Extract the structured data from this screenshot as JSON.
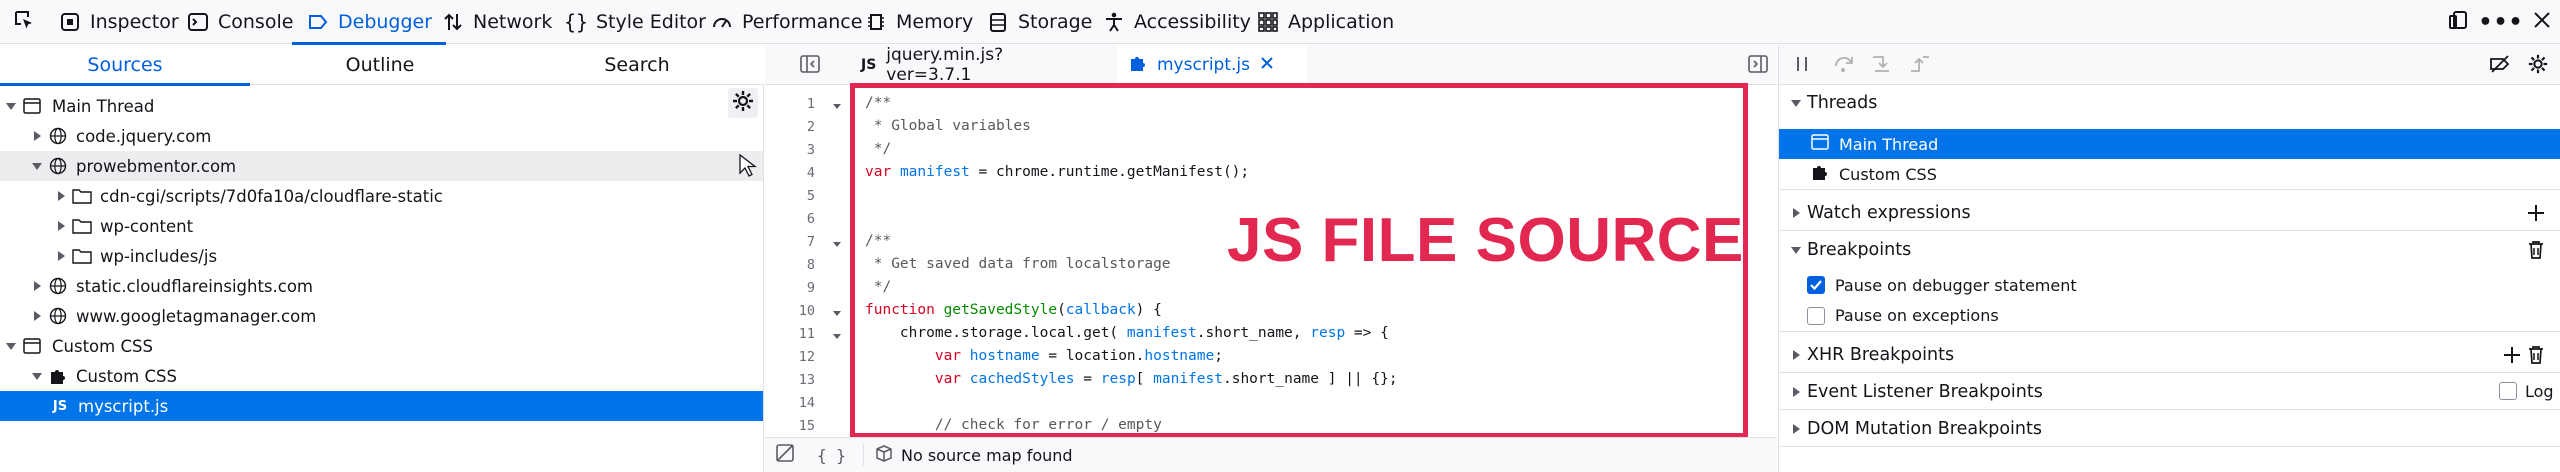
{
  "toolbar": {
    "tabs": [
      {
        "label": "Inspector",
        "icon": "inspector-icon"
      },
      {
        "label": "Console",
        "icon": "console-icon"
      },
      {
        "label": "Debugger",
        "icon": "debugger-icon"
      },
      {
        "label": "Network",
        "icon": "network-icon"
      },
      {
        "label": "Style Editor",
        "icon": "style-editor-icon"
      },
      {
        "label": "Performance",
        "icon": "performance-icon"
      },
      {
        "label": "Memory",
        "icon": "memory-icon"
      },
      {
        "label": "Storage",
        "icon": "storage-icon"
      },
      {
        "label": "Accessibility",
        "icon": "accessibility-icon"
      },
      {
        "label": "Application",
        "icon": "application-icon"
      }
    ],
    "selected_tab": "Debugger"
  },
  "sources_panel": {
    "tabs": [
      "Sources",
      "Outline",
      "Search"
    ],
    "selected_tab": "Sources",
    "tree": [
      {
        "label": "Main Thread",
        "type": "thread",
        "expanded": true
      },
      {
        "label": "code.jquery.com",
        "type": "domain",
        "expanded": false
      },
      {
        "label": "prowebmentor.com",
        "type": "domain",
        "expanded": true
      },
      {
        "label": "cdn-cgi/scripts/7d0fa10a/cloudflare-static",
        "type": "folder",
        "expanded": false
      },
      {
        "label": "wp-content",
        "type": "folder",
        "expanded": false
      },
      {
        "label": "wp-includes/js",
        "type": "folder",
        "expanded": false
      },
      {
        "label": "static.cloudflareinsights.com",
        "type": "domain",
        "expanded": false
      },
      {
        "label": "www.googletagmanager.com",
        "type": "domain",
        "expanded": false
      },
      {
        "label": "Custom CSS",
        "type": "thread",
        "expanded": true
      },
      {
        "label": "Custom CSS",
        "type": "extension",
        "expanded": true
      },
      {
        "label": "myscript.js",
        "type": "file",
        "badge": "JS"
      }
    ],
    "selected_file": "myscript.js"
  },
  "editor": {
    "tabs": [
      {
        "label": "jquery.min.js?ver=3.7.1",
        "badge": "JS"
      },
      {
        "label": "myscript.js",
        "closable": true
      }
    ],
    "selected_tab": "myscript.js",
    "lines": [
      {
        "n": "1",
        "text": "/**"
      },
      {
        "n": "2",
        "text": " * Global variables"
      },
      {
        "n": "3",
        "text": " */"
      },
      {
        "n": "4",
        "text": "var manifest = chrome.runtime.getManifest();"
      },
      {
        "n": "5",
        "text": ""
      },
      {
        "n": "6",
        "text": ""
      },
      {
        "n": "7",
        "text": "/**"
      },
      {
        "n": "8",
        "text": " * Get saved data from localstorage"
      },
      {
        "n": "9",
        "text": " */"
      },
      {
        "n": "10",
        "text": "function getSavedStyle(callback) {"
      },
      {
        "n": "11",
        "text": "    chrome.storage.local.get( manifest.short_name, resp => {"
      },
      {
        "n": "12",
        "text": "        var hostname = location.hostname;"
      },
      {
        "n": "13",
        "text": "        var cachedStyles = resp[ manifest.short_name ] || {};"
      },
      {
        "n": "14",
        "text": ""
      },
      {
        "n": "15",
        "text": "        // check for error / empty"
      }
    ],
    "overlay_label": "JS FILE SOURCE",
    "footer": {
      "pretty_print": "{ }",
      "source_map": "No source map found"
    }
  },
  "debugger_panel": {
    "threads_title": "Threads",
    "threads": [
      {
        "label": "Main Thread",
        "selected": true
      },
      {
        "label": "Custom CSS",
        "selected": false
      }
    ],
    "watch_title": "Watch expressions",
    "breakpoints_title": "Breakpoints",
    "pause_on_debugger": {
      "label": "Pause on debugger statement",
      "checked": true
    },
    "pause_on_exceptions": {
      "label": "Pause on exceptions",
      "checked": false
    },
    "xhr_title": "XHR Breakpoints",
    "event_listener_title": "Event Listener Breakpoints",
    "log_label": "Log",
    "dom_mutation_title": "DOM Mutation Breakpoints"
  },
  "colors": {
    "accent": "#0060df",
    "selection": "#0074e8",
    "annotation": "#e22850"
  }
}
